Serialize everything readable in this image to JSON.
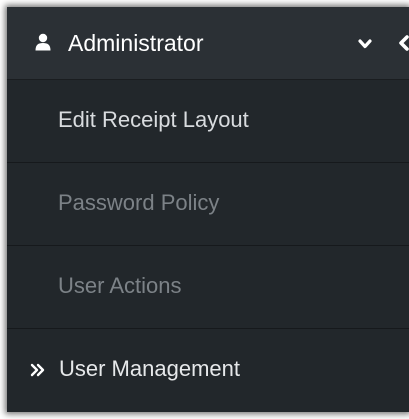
{
  "header": {
    "title": "Administrator",
    "icon": "user-icon",
    "toggle_icon": "chevron-down-icon",
    "back_icon": "chevron-left-icon"
  },
  "menu": {
    "items": [
      {
        "label": "Edit Receipt Layout",
        "state": "bright"
      },
      {
        "label": "Password Policy",
        "state": "dim"
      },
      {
        "label": "User Actions",
        "state": "dim"
      },
      {
        "label": "User Management",
        "state": "active",
        "marker": "double-chevron-right-icon"
      }
    ]
  },
  "colors": {
    "background": "#22272b",
    "header_background": "#2b3035",
    "text_bright": "#d9dcdf",
    "text_dim": "#7c8287",
    "divider": "#16191c"
  }
}
